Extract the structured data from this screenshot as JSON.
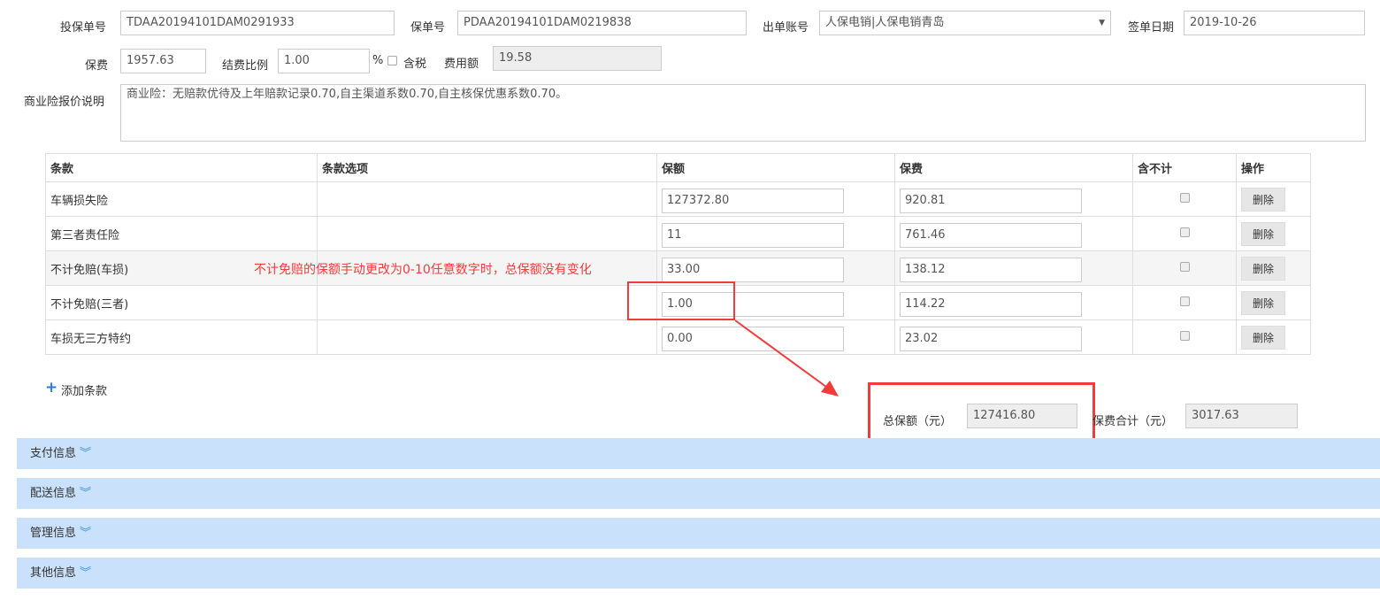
{
  "form": {
    "proposal_no_label": "投保单号",
    "proposal_no": "TDAA20194101DAM0291933",
    "policy_no_label": "保单号",
    "policy_no": "PDAA20194101DAM0219838",
    "account_label": "出单账号",
    "account": "人保电销|人保电销青岛",
    "sign_date_label": "签单日期",
    "sign_date": "2019-10-26",
    "premium_label": "保费",
    "premium": "1957.63",
    "fee_ratio_label": "结费比例",
    "fee_ratio": "1.00",
    "percent": "%",
    "tax_label": "含税",
    "fee_amount_label": "费用额",
    "fee_amount": "19.58",
    "quote_desc_label": "商业险报价说明",
    "quote_desc": "商业险：无赔款优待及上年赔款记录0.70,自主渠道系数0.70,自主核保优惠系数0.70。"
  },
  "table": {
    "headers": [
      "条款",
      "条款选项",
      "保额",
      "保费",
      "含不计",
      "操作"
    ],
    "rows": [
      {
        "clause": "车辆损失险",
        "option": "",
        "amount": "127372.80",
        "premium": "920.81",
        "action": "删除"
      },
      {
        "clause": "第三者责任险",
        "option": "",
        "amount": "11",
        "premium": "761.46",
        "action": "删除"
      },
      {
        "clause": "不计免赔(车损)",
        "option": "",
        "amount": "33.00",
        "premium": "138.12",
        "action": "删除"
      },
      {
        "clause": "不计免赔(三者)",
        "option": "",
        "amount": "1.00",
        "premium": "114.22",
        "action": "删除"
      },
      {
        "clause": "车损无三方特约",
        "option": "",
        "amount": "0.00",
        "premium": "23.02",
        "action": "删除"
      }
    ]
  },
  "add_clause": "添加条款",
  "annotation": "不计免赔的保额手动更改为0-10任意数字时，总保额没有变化",
  "totals": {
    "amount_label": "总保额（元）",
    "amount": "127416.80",
    "premium_label": "保费合计（元）",
    "premium": "3017.63"
  },
  "sections": [
    "支付信息",
    "配送信息",
    "管理信息",
    "其他信息"
  ],
  "colors": {
    "section_bg": "#c9e1fb",
    "annotation": "#f23b3b"
  }
}
